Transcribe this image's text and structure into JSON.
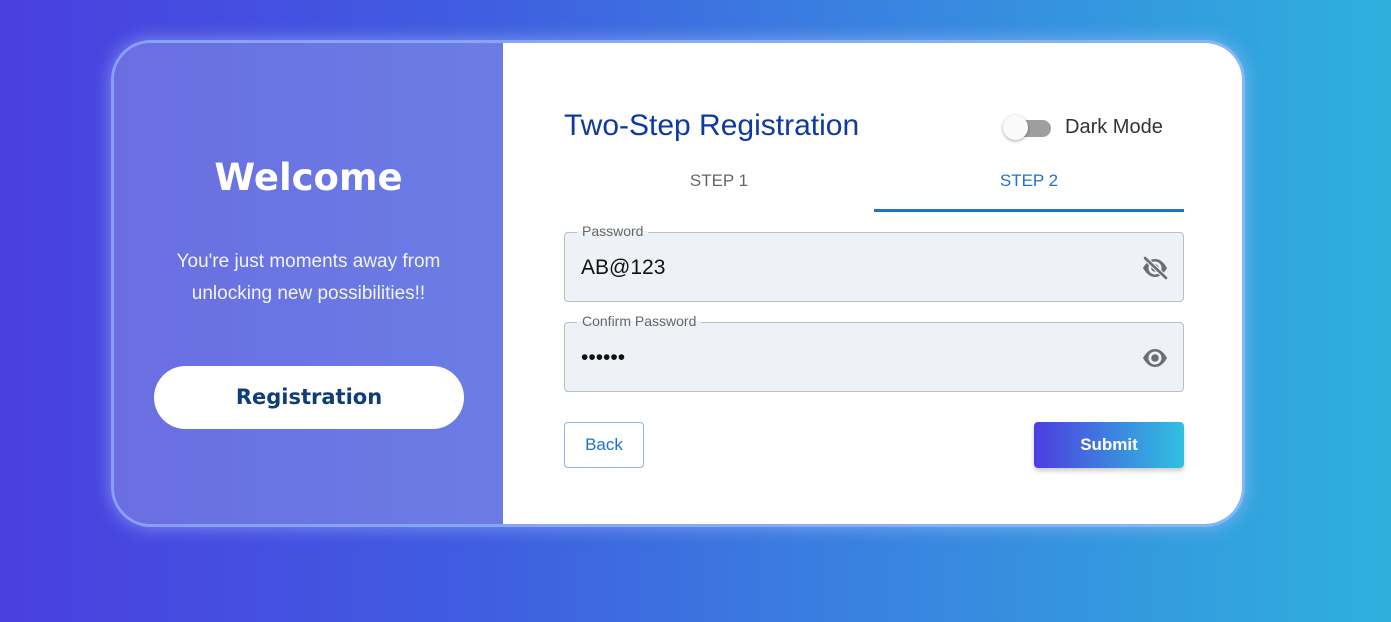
{
  "left_panel": {
    "heading": "Welcome",
    "tagline": "You're just moments away from unlocking new possibilities!!",
    "button_label": "Registration"
  },
  "form": {
    "title": "Two-Step Registration",
    "dark_mode": {
      "label": "Dark Mode",
      "enabled": false
    },
    "tabs": [
      {
        "label": "STEP 1",
        "active": false
      },
      {
        "label": "STEP 2",
        "active": true
      }
    ],
    "password": {
      "label": "Password",
      "value": "AB@123",
      "visible": true,
      "icon": "eye-off-icon"
    },
    "confirm_password": {
      "label": "Confirm Password",
      "value": "AB@123",
      "visible": false,
      "icon": "eye-icon"
    },
    "back_label": "Back",
    "submit_label": "Submit"
  },
  "colors": {
    "title": "#0c3aa0",
    "accent": "#1e73c9",
    "submit_gradient_start": "#4d3ddf",
    "submit_gradient_end": "#2fc2e0",
    "left_panel": "#6a72e3"
  }
}
